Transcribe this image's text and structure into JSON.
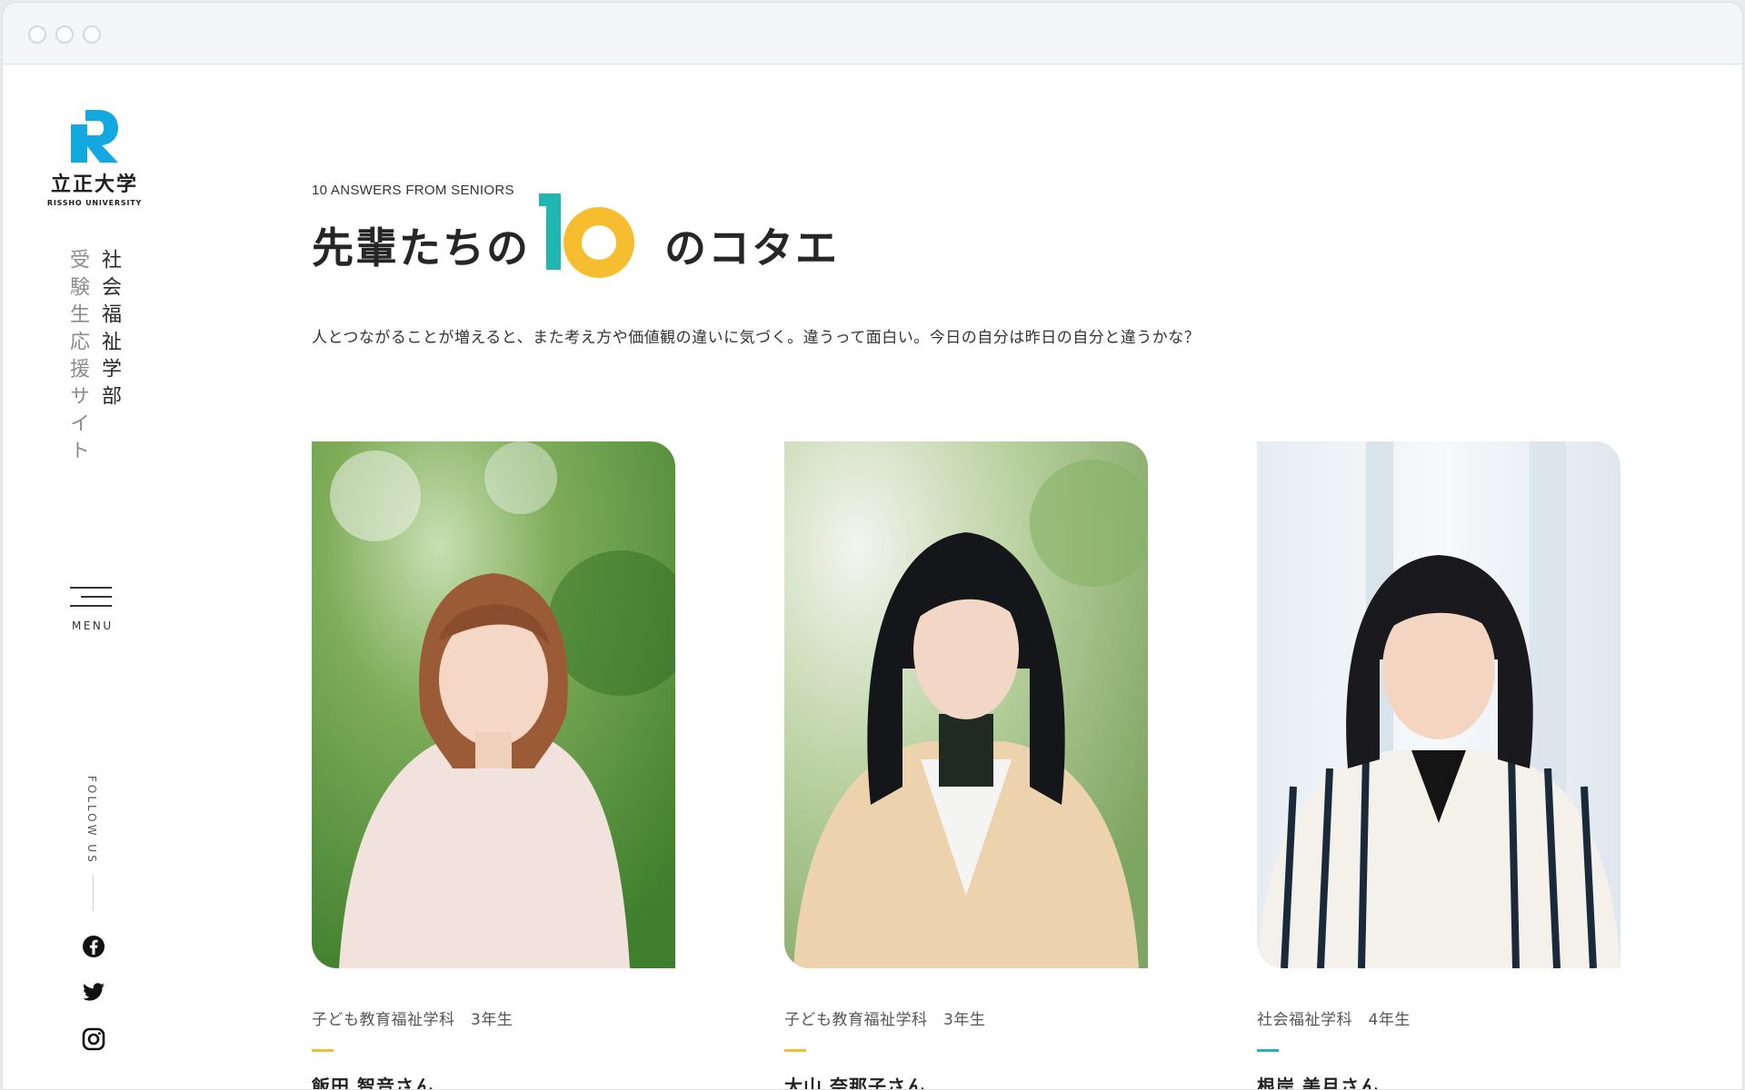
{
  "brand": {
    "logo_jp": "立正大学",
    "logo_en": "RISSHO UNIVERSITY",
    "colors": {
      "logo_blue": "#13a8e0",
      "teal": "#1fb7b1",
      "yellow": "#f6bd2e"
    }
  },
  "sidebar": {
    "department": "社会福祉学部",
    "site_name": "受験生応援サイト",
    "menu_label": "MENU",
    "follow_label": "FOLLOW US",
    "social": [
      {
        "icon": "facebook-icon"
      },
      {
        "icon": "twitter-icon"
      },
      {
        "icon": "instagram-icon"
      }
    ]
  },
  "header": {
    "eyebrow": "10 ANSWERS FROM SENIORS",
    "title_prefix": "先輩たちの",
    "title_number": "10",
    "title_suffix": "のコタエ",
    "lead": "人とつながることが増えると、また考え方や価値観の違いに気づく。違うって面白い。今日の自分は昨日の自分と違うかな？"
  },
  "cards": [
    {
      "course": "子ども教育福祉学科　3年生",
      "name": "飯田 智音さん",
      "accent": "#f6bd2e",
      "photo": "student-photo-1"
    },
    {
      "course": "子ども教育福祉学科　3年生",
      "name": "大山 奈那子さん",
      "accent": "#f6bd2e",
      "photo": "student-photo-2"
    },
    {
      "course": "社会福祉学科　4年生",
      "name": "根岸 美月さん",
      "accent": "#1fb7b1",
      "photo": "student-photo-3"
    }
  ]
}
